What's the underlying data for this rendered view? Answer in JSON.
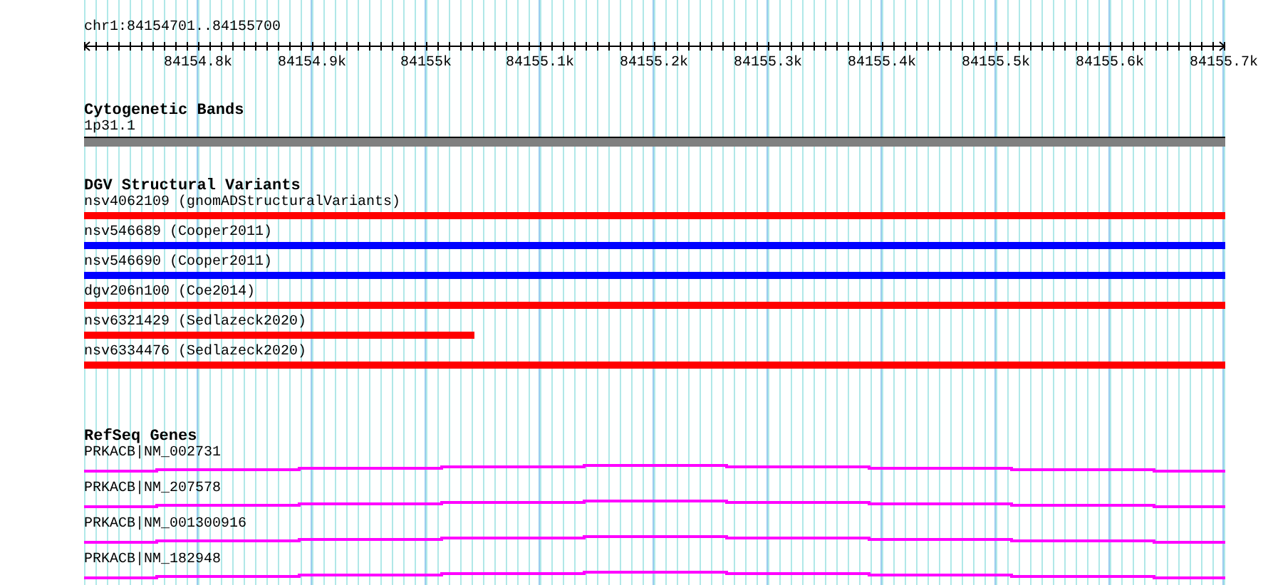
{
  "ruler": {
    "title": "chr1:84154701..84155700",
    "ticks": [
      "84154.8k",
      "84154.9k",
      "84155k",
      "84155.1k",
      "84155.2k",
      "84155.3k",
      "84155.4k",
      "84155.5k",
      "84155.6k",
      "84155.7k"
    ]
  },
  "tracks": [
    {
      "kind": "bands",
      "title": "Cytogenetic Bands",
      "features": [
        {
          "label": "1p31.1",
          "color": "#808080"
        }
      ]
    },
    {
      "kind": "variants",
      "title": "DGV Structural Variants",
      "features": [
        {
          "label": "nsv4062109 (gnomADStructuralVariants)",
          "color": "#ff0000",
          "level": 1
        },
        {
          "label": "nsv546689 (Cooper2011)",
          "color": "#0000ff",
          "level": 1
        },
        {
          "label": "nsv546690 (Cooper2011)",
          "color": "#0000ff",
          "level": 1
        },
        {
          "label": "dgv206n100 (Coe2014)",
          "color": "#ff0000",
          "level": 1
        },
        {
          "label": "nsv6321429 (Sedlazeck2020)",
          "color": "#ff0000",
          "level": 0.342
        },
        {
          "label": "nsv6334476 (Sedlazeck2020)",
          "color": "#ff0000",
          "level": 1
        }
      ]
    },
    {
      "kind": "genes",
      "title": "RefSeq Genes",
      "features": [
        {
          "label": "PRKACB|NM_002731"
        },
        {
          "label": "PRKACB|NM_207578"
        },
        {
          "label": "PRKACB|NM_001300916"
        },
        {
          "label": "PRKACB|NM_182948"
        }
      ]
    }
  ]
}
